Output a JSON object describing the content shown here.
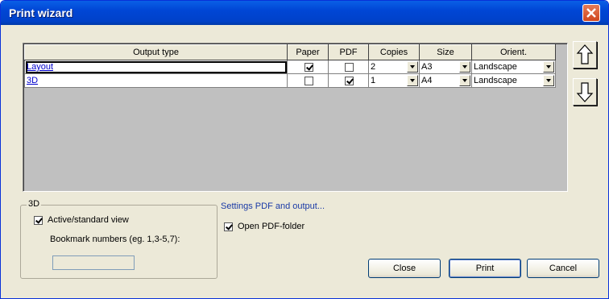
{
  "window": {
    "title": "Print wizard",
    "close_icon": "close-icon"
  },
  "grid": {
    "headers": [
      "Output type",
      "Paper",
      "PDF",
      "Copies",
      "Size",
      "Orient."
    ],
    "rows": [
      {
        "name": "Layout",
        "paper": true,
        "pdf": false,
        "copies": "2",
        "size": "A3",
        "orient": "Landscape"
      },
      {
        "name": "3D",
        "paper": false,
        "pdf": true,
        "copies": "1",
        "size": "A4",
        "orient": "Landscape"
      }
    ]
  },
  "move_buttons": {
    "up_icon": "arrow-up-icon",
    "down_icon": "arrow-down-icon"
  },
  "group3d": {
    "legend": "3D",
    "active_view_label": "Active/standard view",
    "active_view_checked": true,
    "bookmark_label": "Bookmark numbers (eg. 1,3-5,7):",
    "bookmark_value": ""
  },
  "pdf_settings": {
    "link_label": "Settings PDF and output...",
    "open_folder_label": "Open PDF-folder",
    "open_folder_checked": true
  },
  "buttons": {
    "close": "Close",
    "print": "Print",
    "cancel": "Cancel"
  }
}
